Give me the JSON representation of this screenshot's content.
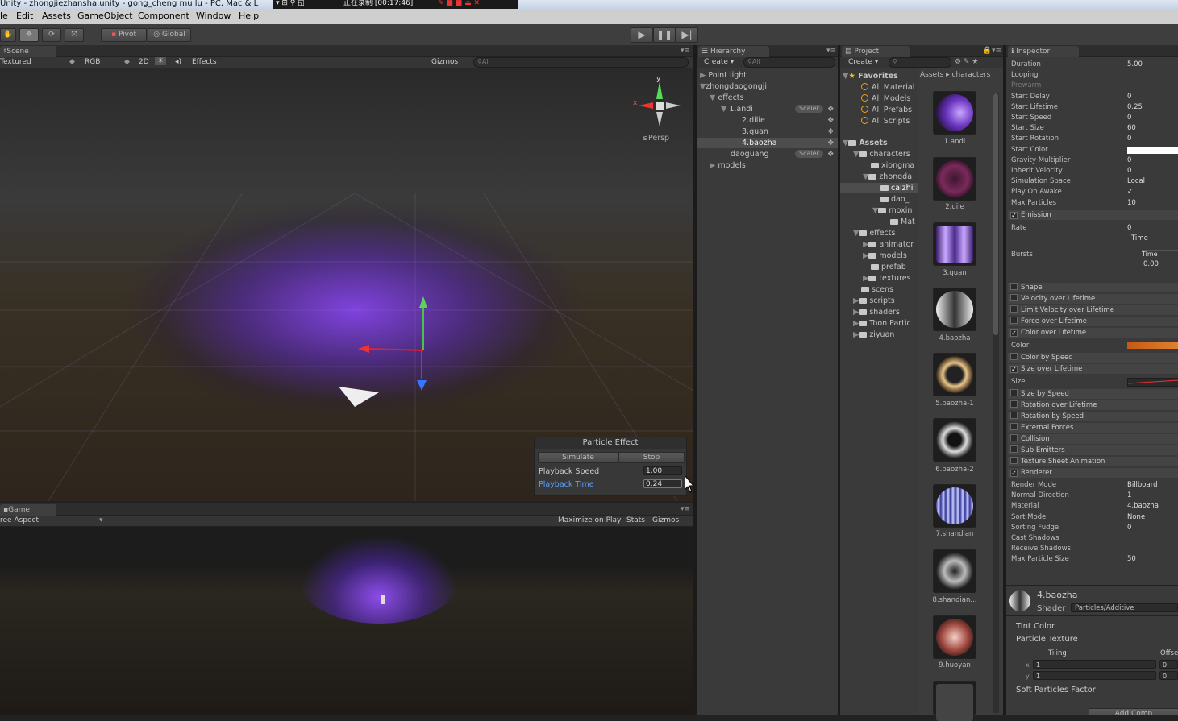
{
  "title_bar": {
    "text": "Unity - zhongjiezhansha.unity - gong_cheng mu lu - PC, Mac & L",
    "recording": "正在录制 [00:17:46]"
  },
  "menu": [
    "le",
    "Edit",
    "Assets",
    "GameObject",
    "Component",
    "Window",
    "Help"
  ],
  "toolbar": {
    "pivot": "Pivot",
    "global": "Global"
  },
  "scene": {
    "tab": "Scene",
    "shading": "Textured",
    "rgb": "RGB",
    "mode_2d": "2D",
    "effects": "Effects",
    "gizmos": "Gizmos",
    "search_placeholder": "All",
    "persp": "Persp",
    "axis_y": "y",
    "axis_x": "x",
    "particle_effect": {
      "title": "Particle Effect",
      "simulate": "Simulate",
      "stop": "Stop",
      "speed_label": "Playback Speed",
      "speed_value": "1.00",
      "time_label": "Playback Time",
      "time_value": "0.24"
    }
  },
  "game": {
    "tab": "Game",
    "aspect": "ree Aspect",
    "maximize": "Maximize on Play",
    "stats": "Stats",
    "gizmos": "Gizmos"
  },
  "hierarchy": {
    "tab": "Hierarchy",
    "create": "Create",
    "search_placeholder": "All",
    "items": [
      "Point light",
      "zhongdaogongji",
      "effects",
      "1.andi",
      "2.dilie",
      "3.quan",
      "4.baozha",
      "daoguang",
      "models"
    ],
    "scaler": "Scaler"
  },
  "project": {
    "tab": "Project",
    "create": "Create",
    "breadcrumb": [
      "Assets",
      "characters"
    ],
    "favorites": {
      "label": "Favorites",
      "items": [
        "All Material",
        "All Models",
        "All Prefabs",
        "All Scripts"
      ]
    },
    "assets": {
      "label": "Assets",
      "items": [
        "characters",
        "xiongma",
        "zhongda",
        "caizhi",
        "dao_",
        "moxin",
        "Mat",
        "effects",
        "animator",
        "models",
        "prefab",
        "textures",
        "scens",
        "scripts",
        "shaders",
        "Toon Partic",
        "ziyuan"
      ]
    },
    "thumbs": [
      "1.andi",
      "2.dile",
      "3.quan",
      "4.baozha",
      "5.baozha-1",
      "6.baozha-2",
      "7.shandian",
      "8.shandian...",
      "9.huoyan"
    ]
  },
  "inspector": {
    "tab": "Inspector",
    "props": [
      {
        "label": "Duration",
        "value": "5.00"
      },
      {
        "label": "Looping",
        "value": ""
      },
      {
        "label": "Prewarm",
        "value": ""
      },
      {
        "label": "Start Delay",
        "value": "0"
      },
      {
        "label": "Start Lifetime",
        "value": "0.25"
      },
      {
        "label": "Start Speed",
        "value": "0"
      },
      {
        "label": "Start Size",
        "value": "60"
      },
      {
        "label": "Start Rotation",
        "value": "0"
      },
      {
        "label": "Start Color",
        "value": ""
      },
      {
        "label": "Gravity Multiplier",
        "value": "0"
      },
      {
        "label": "Inherit Velocity",
        "value": "0"
      },
      {
        "label": "Simulation Space",
        "value": "Local"
      },
      {
        "label": "Play On Awake",
        "value": "✓"
      },
      {
        "label": "Max Particles",
        "value": "10"
      }
    ],
    "emission": {
      "label": "Emission",
      "rate_label": "Rate",
      "rate_value": "0",
      "rate_unit": "Time",
      "bursts_label": "Bursts",
      "bursts_time_header": "Time",
      "bursts_time": "0.00"
    },
    "modules_a": [
      "Shape",
      "Velocity over Lifetime",
      "Limit Velocity over Lifetime",
      "Force over Lifetime"
    ],
    "color_module": {
      "label": "Color over Lifetime",
      "color_label": "Color",
      "color": "#d0651a"
    },
    "color_by_speed": "Color by Speed",
    "size_module": {
      "label": "Size over Lifetime",
      "size_label": "Size"
    },
    "modules_b": [
      "Size by Speed",
      "Rotation over Lifetime",
      "Rotation by Speed",
      "External Forces",
      "Collision",
      "Sub Emitters",
      "Texture Sheet Animation"
    ],
    "renderer": {
      "label": "Renderer",
      "props": [
        {
          "label": "Render Mode",
          "value": "Billboard"
        },
        {
          "label": "Normal Direction",
          "value": "1"
        },
        {
          "label": "Material",
          "value": "4.baozha"
        },
        {
          "label": "Sort Mode",
          "value": "None"
        },
        {
          "label": "Sorting Fudge",
          "value": "0"
        },
        {
          "label": "Cast Shadows",
          "value": ""
        },
        {
          "label": "Receive Shadows",
          "value": ""
        },
        {
          "label": "Max Particle Size",
          "value": "50"
        }
      ]
    },
    "material": {
      "name": "4.baozha",
      "shader_label": "Shader",
      "shader": "Particles/Additive",
      "tint": "Tint Color",
      "texture": "Particle Texture",
      "tiling": "Tiling",
      "offset": "Offse",
      "x_label": "x",
      "y_label": "y",
      "tx": "1",
      "ty": "1",
      "ox": "0",
      "oy": "0",
      "soft": "Soft Particles Factor",
      "add_component": "Add Comp"
    }
  }
}
